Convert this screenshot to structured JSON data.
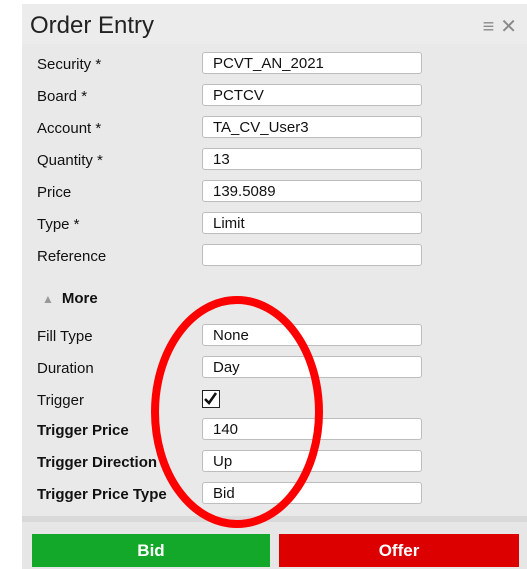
{
  "header": {
    "title": "Order Entry"
  },
  "icons": {
    "menu": "hamburger-icon",
    "close": "close-icon"
  },
  "fields": {
    "security": {
      "label": "Security *",
      "value": "PCVT_AN_2021"
    },
    "board": {
      "label": "Board *",
      "value": "PCTCV"
    },
    "account": {
      "label": "Account *",
      "value": "TA_CV_User3"
    },
    "quantity": {
      "label": "Quantity *",
      "value": "13"
    },
    "price": {
      "label": "Price",
      "value": "139.5089"
    },
    "type": {
      "label": "Type *",
      "value": "Limit"
    },
    "reference": {
      "label": "Reference",
      "value": ""
    }
  },
  "more": {
    "label": "More"
  },
  "advanced": {
    "fill_type": {
      "label": "Fill Type",
      "value": "None"
    },
    "duration": {
      "label": "Duration",
      "value": "Day"
    },
    "trigger": {
      "label": "Trigger",
      "checked": true
    },
    "trigger_price": {
      "label": "Trigger Price",
      "value": "140"
    },
    "trigger_direction": {
      "label": "Trigger Direction",
      "value": "Up"
    },
    "trigger_price_type": {
      "label": "Trigger Price Type",
      "value": "Bid"
    }
  },
  "buttons": {
    "bid": "Bid",
    "offer": "Offer"
  },
  "colors": {
    "bid": "#13a829",
    "offer": "#dd0000",
    "annotation": "#ff0000"
  }
}
